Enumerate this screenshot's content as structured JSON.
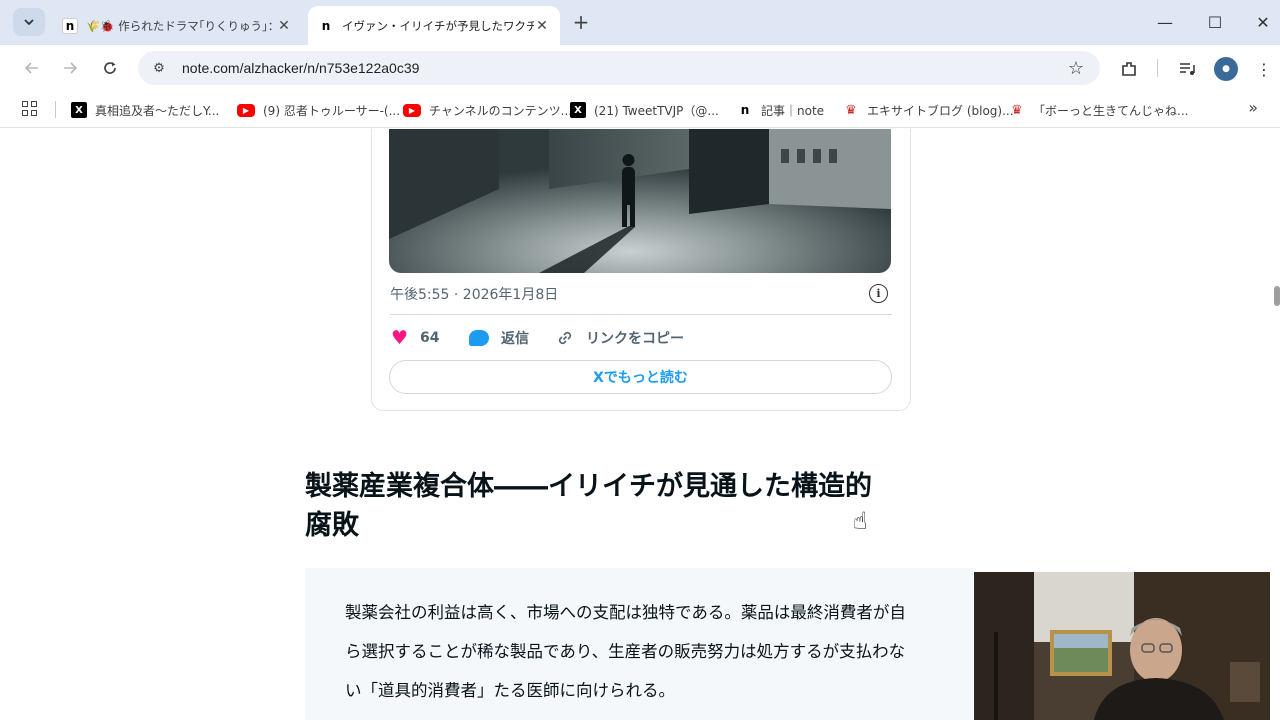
{
  "browser": {
    "tabs": [
      {
        "title": "🌾🐞 作られたドラマ｢りくりゅう｣：",
        "favicon": "n"
      },
      {
        "title": "イヴァン・イリイチが予見したワクチン",
        "favicon": "n",
        "active": true
      }
    ],
    "window_controls": {
      "minimize": "—",
      "maximize": "☐",
      "close": "✕"
    },
    "url": "note.com/alzhacker/n/n753e122a0c39",
    "bookmarks": [
      {
        "label": "真相追及者～ただしY...",
        "icon": "x-icon"
      },
      {
        "label": "(9) 忍者トゥルーサー-(...",
        "icon": "youtube-icon"
      },
      {
        "label": "チャンネルのコンテンツ...",
        "icon": "youtube-icon"
      },
      {
        "label": "(21) TweetTVJP（@...",
        "icon": "x-icon"
      },
      {
        "label": "記事｜note",
        "icon": "note-icon"
      },
      {
        "label": "エキサイトブログ (blog)...",
        "icon": "excite-icon"
      },
      {
        "label": "「ボーっと生きてんじゃね...",
        "icon": "excite-icon"
      }
    ]
  },
  "tweet": {
    "timestamp": "午後5:55 · 2026年1月8日",
    "likes": "64",
    "reply_label": "返信",
    "copy_link_label": "リンクをコピー",
    "read_more_label": "Xでもっと読む"
  },
  "article": {
    "heading_line1": "製薬産業複合体――イリイチが見通した構造的",
    "heading_line2": "腐敗",
    "quote_lines": [
      "製薬会社の利益は高く、市場への支配は独特である。薬品は最終消費者が自",
      "ら選択することが稀な製品であり、生産者の販売努力は処方するが支払わな",
      "い「道具的消費者」たる医師に向けられる。"
    ]
  },
  "colors": {
    "like": "#f91880",
    "reply": "#1d9bf0",
    "link": "#1d9bf0"
  }
}
